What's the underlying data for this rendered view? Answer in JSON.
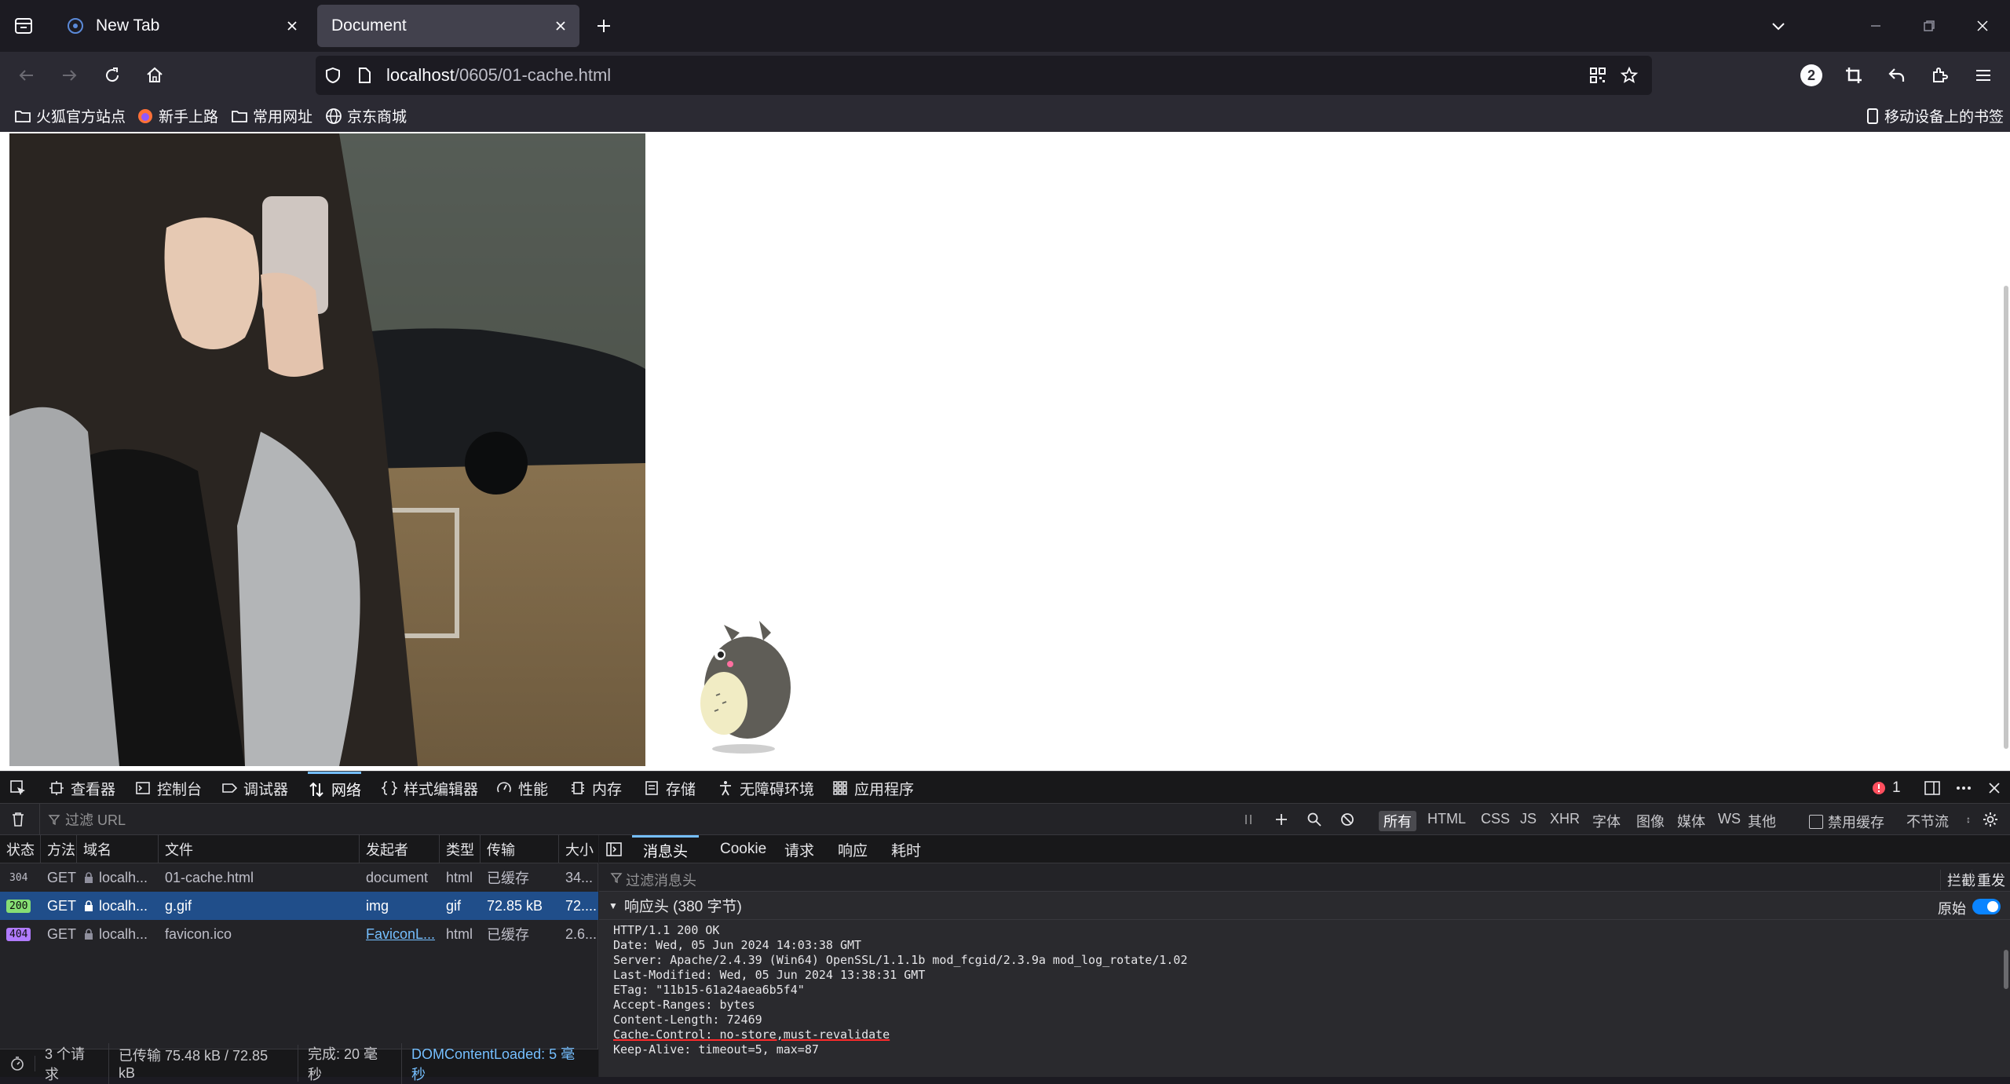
{
  "tabs": [
    {
      "title": "New Tab"
    },
    {
      "title": "Document"
    }
  ],
  "url": {
    "host": "localhost",
    "path": "/0605/01-cache.html"
  },
  "toolbar": {
    "notification_count": "2"
  },
  "bookmarks": [
    {
      "label": "火狐官方站点",
      "icon": "folder-icon"
    },
    {
      "label": "新手上路",
      "icon": "firefox-icon"
    },
    {
      "label": "常用网址",
      "icon": "folder-icon"
    },
    {
      "label": "京东商城",
      "icon": "globe-icon"
    }
  ],
  "mobile_bookmarks": "移动设备上的书签",
  "devtools": {
    "tabs": [
      {
        "label": "查看器",
        "icon": "inspector-icon"
      },
      {
        "label": "控制台",
        "icon": "console-icon"
      },
      {
        "label": "调试器",
        "icon": "debugger-icon"
      },
      {
        "label": "网络",
        "icon": "network-icon"
      },
      {
        "label": "样式编辑器",
        "icon": "style-editor-icon"
      },
      {
        "label": "性能",
        "icon": "performance-icon"
      },
      {
        "label": "内存",
        "icon": "memory-icon"
      },
      {
        "label": "存储",
        "icon": "storage-icon"
      },
      {
        "label": "无障碍环境",
        "icon": "accessibility-icon"
      },
      {
        "label": "应用程序",
        "icon": "application-icon"
      }
    ],
    "error_count": "1",
    "filter_placeholder": "过滤 URL",
    "type_filters": [
      "所有",
      "HTML",
      "CSS",
      "JS",
      "XHR",
      "字体",
      "图像",
      "媒体",
      "WS",
      "其他"
    ],
    "disable_cache": "禁用缓存",
    "throttle": "不节流",
    "columns": [
      "状态",
      "方法",
      "域名",
      "文件",
      "发起者",
      "类型",
      "传输",
      "大小"
    ],
    "requests": [
      {
        "status": "304",
        "method": "GET",
        "domain": "localh...",
        "file": "01-cache.html",
        "initiator": "document",
        "type": "html",
        "transfer": "已缓存",
        "size": "34..."
      },
      {
        "status": "200",
        "method": "GET",
        "domain": "localh...",
        "file": "g.gif",
        "initiator": "img",
        "type": "gif",
        "transfer": "72.85 kB",
        "size": "72...."
      },
      {
        "status": "404",
        "method": "GET",
        "domain": "localh...",
        "file": "favicon.ico",
        "initiator": "FaviconL...",
        "type": "html",
        "transfer": "已缓存",
        "size": "2.6..."
      }
    ],
    "summary": {
      "requests": "3 个请求",
      "transferred": "已传输 75.48 kB / 72.85 kB",
      "finish": "完成: 20 毫秒",
      "dcl": "DOMContentLoaded: 5 毫秒"
    },
    "detail_tabs": [
      "消息头",
      "Cookie",
      "请求",
      "响应",
      "耗时"
    ],
    "header_filter_placeholder": "过滤消息头",
    "block_label": "拦截",
    "resend_label": "重发",
    "response_headers_title": "响应头 (380 字节)",
    "raw_label": "原始",
    "raw_lines": [
      "HTTP/1.1 200 OK",
      "Date: Wed, 05 Jun 2024 14:03:38 GMT",
      "Server: Apache/2.4.39 (Win64) OpenSSL/1.1.1b mod_fcgid/2.3.9a mod_log_rotate/1.02",
      "Last-Modified: Wed, 05 Jun 2024 13:38:31 GMT",
      "ETag: \"11b15-61a24aea6b5f4\"",
      "Accept-Ranges: bytes",
      "Content-Length: 72469",
      "Cache-Control: no-store,must-revalidate",
      "Keep-Alive: timeout=5, max=87"
    ]
  }
}
